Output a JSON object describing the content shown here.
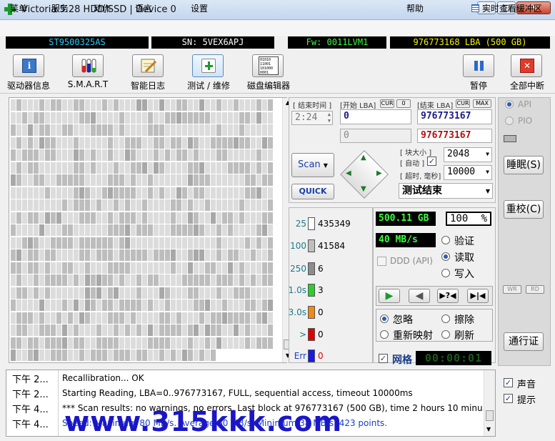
{
  "window": {
    "title": "Victoria 5.28 HDD/SSD | Device 0"
  },
  "menu": {
    "items": [
      "菜单",
      "服务",
      "动作",
      "语言",
      "设置",
      "帮助"
    ],
    "realtime_label": "实时查看缓冲区"
  },
  "info": {
    "model": "ST9500325AS",
    "serial": "SN: 5VEX6APJ",
    "firmware": "Fw: 0011LVM1",
    "capacity": "976773168 LBA (500 GB)"
  },
  "toolbar": {
    "buttons": [
      "驱动器信息",
      "S.M.A.R.T",
      "智能日志",
      "测试 / 维修",
      "磁盘编辑器"
    ],
    "pause_label": "暂停",
    "abort_label": "全部中断",
    "sector_editor_icon_text": "01010\n11001\n101000\n0001"
  },
  "scan": {
    "end_time_label": "[ 结束时间 ]",
    "end_time_value": "2:24",
    "start_lba_label": "[开始 LBA]",
    "cur_label": "CUR",
    "cur_zero": "0",
    "end_lba_label": "[结束 LBA]",
    "max_label": "MAX",
    "start_lba": "0",
    "start_lba_current": "0",
    "end_lba": "976773167",
    "end_lba_current": "976773167",
    "block_size_label": "[ 块大小 ]",
    "auto_label": "[ 自动 ]",
    "block_size": "2048",
    "timeout_label": "[ 超时, 毫秒]",
    "timeout": "10000",
    "scan_button": "Scan",
    "quick_button": "QUICK",
    "status": "测试结束"
  },
  "interface": {
    "api": "API",
    "pio": "PIO",
    "sleep_button": "睡眠(S)",
    "recal_button": "重校(C)",
    "wr": "WR",
    "rd": "RD",
    "passport_button": "通行证"
  },
  "legend": [
    {
      "label": "25",
      "count": "435349",
      "color": "#ffffff"
    },
    {
      "label": "100",
      "count": "41584",
      "color": "#bfbfbf"
    },
    {
      "label": "250",
      "count": "6",
      "color": "#8c8c8c"
    },
    {
      "label": "1.0s",
      "count": "3",
      "color": "#2ecc2e"
    },
    {
      "label": "3.0s",
      "count": "0",
      "color": "#f08a16"
    },
    {
      "label": ">",
      "count": "0",
      "color": "#e00000"
    },
    {
      "label": "Err",
      "count": "0",
      "color": "#1a1ae0"
    }
  ],
  "stats": {
    "bytes": "500.11 GB",
    "percent": "100",
    "percent_sign": "%",
    "speed": "40 MB/s",
    "ddd_label": "DDD (API)",
    "verify": "验证",
    "read": "读取",
    "write": "写入",
    "ignore": "忽略",
    "erase": "擦除",
    "remap": "重新映射",
    "refresh": "刷新",
    "grid_label": "网格",
    "timer": "00:00:01"
  },
  "options": {
    "sound": "声音",
    "hints": "提示"
  },
  "log": [
    {
      "time": "下午 2...",
      "msg": "Recallibration... OK",
      "color": "#000000"
    },
    {
      "time": "下午 2...",
      "msg": "Starting Reading, LBA=0..976773167, FULL, sequential access, timeout 10000ms",
      "color": "#000000"
    },
    {
      "time": "下午 4...",
      "msg": "*** Scan results: no warnings, no errors. Last block at 976773167 (500 GB), time 2 hours 10 minu...",
      "color": "#000000"
    },
    {
      "time": "下午 4...",
      "msg": "Speed: Maximum 80 MB/s. Average 60 MB/s. Minimum 38 MB/s. 423 points.",
      "color": "#1a3ec8"
    }
  ],
  "watermark": "www.315kkk.com",
  "colors": {
    "green_text": "#3cff3c",
    "yellow_text": "#f5f500",
    "cyan_text": "#20e0ff"
  }
}
